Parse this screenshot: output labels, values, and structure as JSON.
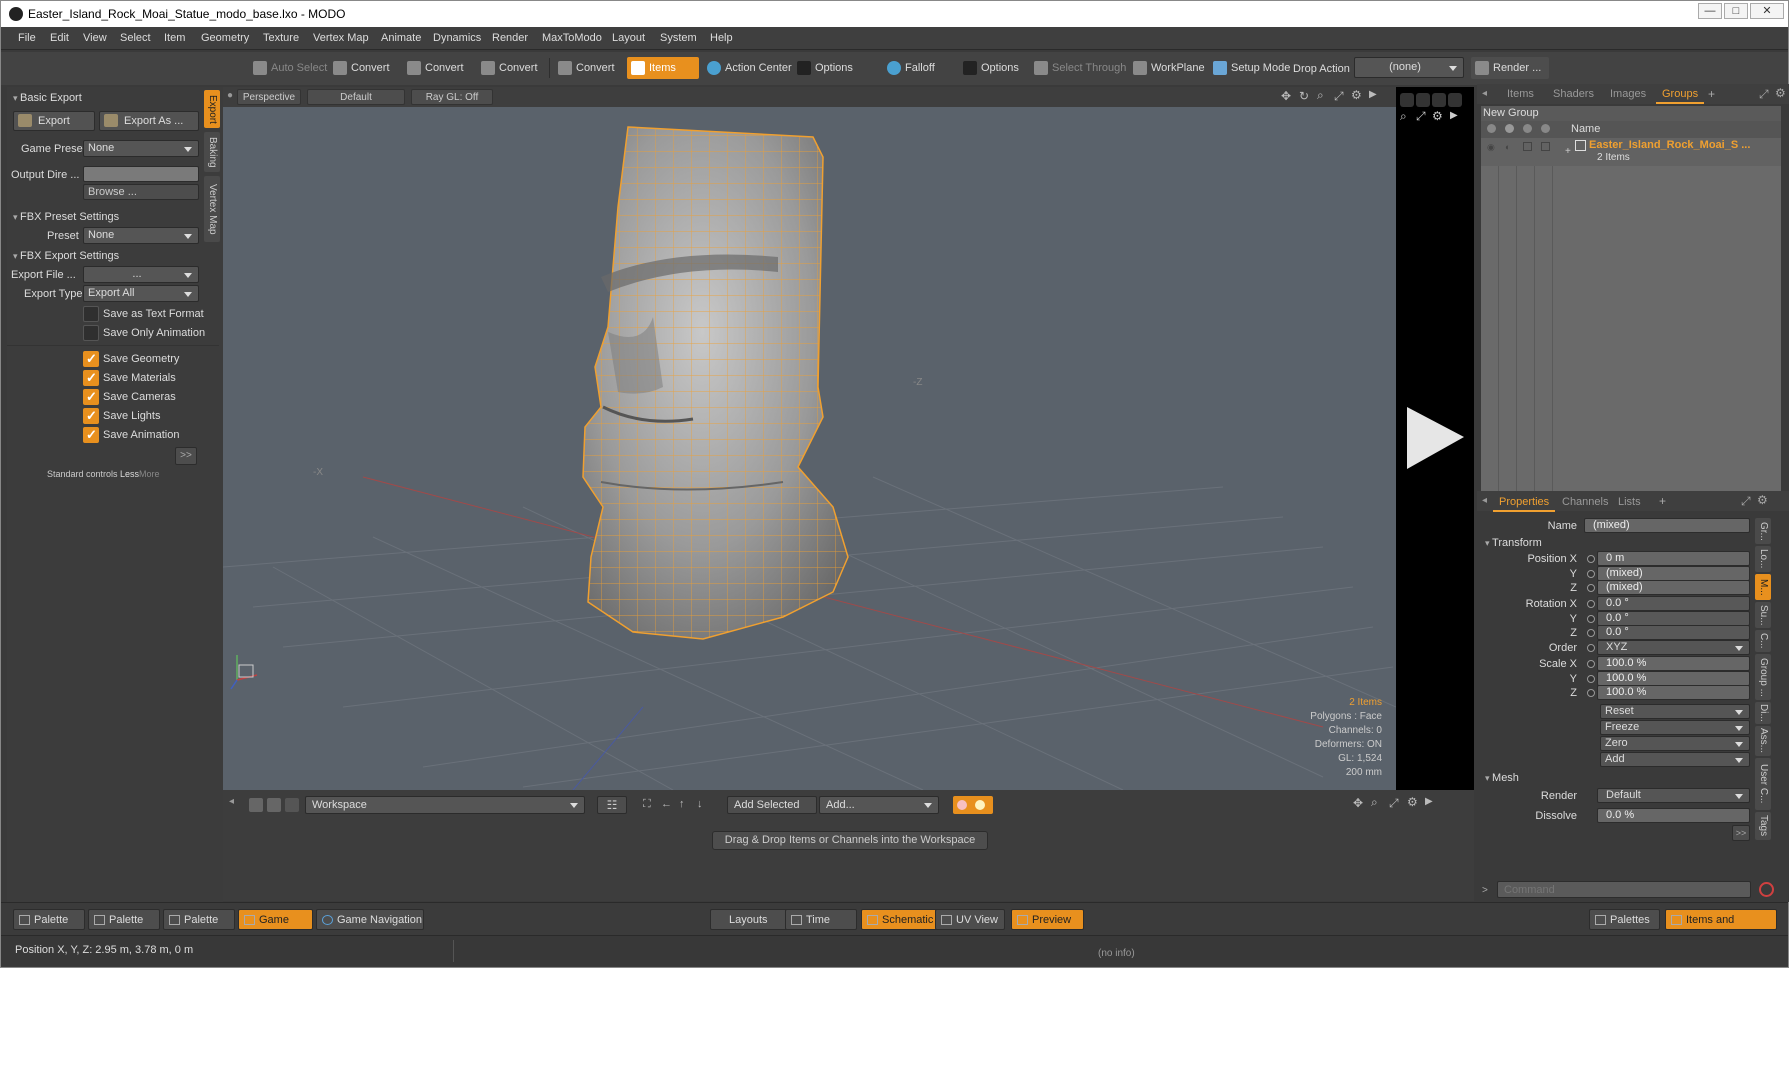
{
  "window": {
    "title": "Easter_Island_Rock_Moai_Statue_modo_base.lxo - MODO",
    "controls": [
      "—",
      "□",
      "✕"
    ]
  },
  "menu": [
    "File",
    "Edit",
    "View",
    "Select",
    "Item",
    "Geometry",
    "Texture",
    "Vertex Map",
    "Animate",
    "Dynamics",
    "Render",
    "MaxToModo",
    "Layout",
    "System",
    "Help"
  ],
  "toolbar": {
    "auto_select": "Auto Select",
    "convert": "Convert",
    "items": "Items",
    "action_center": "Action Center",
    "options": "Options",
    "falloff": "Falloff",
    "select_through": "Select Through",
    "workplane": "WorkPlane",
    "setup_mode": "Setup Mode",
    "drop_action_label": "Drop Action",
    "drop_action_value": "(none)",
    "render": "Render ..."
  },
  "left_panel": {
    "basic_export": "Basic Export",
    "export_btn": "Export",
    "export_as_btn": "Export As ...",
    "game_preset_label": "Game Preset",
    "game_preset_value": "None",
    "output_dir_label": "Output Dire ...",
    "browse": "Browse ...",
    "fbx_preset_settings": "FBX Preset Settings",
    "preset_label": "Preset",
    "preset_value": "None",
    "fbx_export_settings": "FBX Export Settings",
    "export_file_label": "Export File ...",
    "export_file_value": "...",
    "export_type_label": "Export Type",
    "export_type_value": "Export All",
    "checkboxes": [
      {
        "label": "Save as Text Format",
        "checked": false
      },
      {
        "label": "Save Only Animation",
        "checked": false
      },
      {
        "label": "Save Geometry",
        "checked": true
      },
      {
        "label": "Save Materials",
        "checked": true
      },
      {
        "label": "Save Cameras",
        "checked": true
      },
      {
        "label": "Save Lights",
        "checked": true
      },
      {
        "label": "Save Animation",
        "checked": true
      }
    ],
    "more_arrow": ">>",
    "standard_controls": "Standard controls",
    "less": "Less",
    "more": "More",
    "vtabs": [
      "Export",
      "Baking",
      "Vertex Map"
    ]
  },
  "viewport": {
    "perspective": "Perspective",
    "default": "Default",
    "raygl": "Ray GL: Off",
    "axis_z": "-Z",
    "axis_x": "-X",
    "info": {
      "items": "2 Items",
      "polygons": "Polygons : Face",
      "channels": "Channels: 0",
      "deformers": "Deformers: ON",
      "gl": "GL: 1,524",
      "scale": "200 mm"
    },
    "mesh_color": "#f0a030"
  },
  "workspace": {
    "dropdown": "Workspace",
    "add_selected": "Add Selected",
    "add": "Add...",
    "hint": "Drag & Drop Items or Channels into the Workspace"
  },
  "right_panel": {
    "top_tabs": [
      "Items",
      "Shaders",
      "Images",
      "Groups"
    ],
    "new_group": "New Group",
    "name_col": "Name",
    "group_name": "Easter_Island_Rock_Moai_S ...",
    "group_count": "2 Items",
    "prop_tabs": [
      "Properties",
      "Channels",
      "Lists"
    ],
    "name_label": "Name",
    "name_value": "(mixed)",
    "transform": "Transform",
    "position_x_label": "Position X",
    "position_x": "0 m",
    "position_y": "(mixed)",
    "position_z": "(mixed)",
    "rotation_x_label": "Rotation X",
    "rotation_x": "0.0 °",
    "rotation_y": "0.0 °",
    "rotation_z": "0.0 °",
    "order_label": "Order",
    "order_value": "XYZ",
    "scale_x_label": "Scale X",
    "scale_x": "100.0 %",
    "scale_y": "100.0 %",
    "scale_z": "100.0 %",
    "y": "Y",
    "z": "Z",
    "reset": "Reset",
    "freeze": "Freeze",
    "zero": "Zero",
    "add": "Add",
    "mesh": "Mesh",
    "render_label": "Render",
    "render_value": "Default",
    "dissolve_label": "Dissolve",
    "dissolve_value": "0.0 %",
    "more_arrow": ">>",
    "command_placeholder": "Command",
    "side_tabs": [
      "Gr...",
      "Lo...",
      "M...",
      "Su...",
      "C...",
      "Group ...",
      "Di...",
      "Ass...",
      "User C...",
      "Tags"
    ]
  },
  "bottom": {
    "palette": "Palette",
    "game_tools": "Game Tools",
    "game_navigation": "Game Navigation",
    "layouts": "Layouts",
    "time": "Time",
    "schematic": "Schematic",
    "uv_view": "UV View",
    "preview": "Preview",
    "palettes": "Palettes",
    "items_and_shading": "Items and Shading"
  },
  "status": {
    "position": "Position X, Y, Z:   2.95 m, 3.78 m, 0 m",
    "info": "(no info)"
  }
}
